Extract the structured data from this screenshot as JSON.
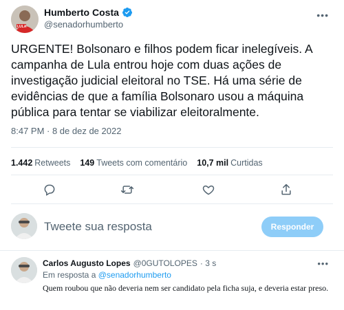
{
  "author": {
    "name": "Humberto Costa",
    "handle": "@senadorhumberto",
    "avatar_badge": "LULA"
  },
  "tweet": {
    "text": "URGENTE!  Bolsonaro e filhos podem ficar inelegíveis. A campanha de Lula entrou hoje com duas ações de investigação judicial eleitoral no TSE. Há uma série de evidências de que a família Bolsonaro usou a máquina pública para tentar se viabilizar eleitoralmente.",
    "timestamp": "8:47 PM · 8 de dez de 2022"
  },
  "stats": {
    "retweets_count": "1.442",
    "retweets_label": "Retweets",
    "quotes_count": "149",
    "quotes_label": "Tweets com comentário",
    "likes_count": "10,7 mil",
    "likes_label": "Curtidas"
  },
  "actions": [
    "reply-icon",
    "retweet-icon",
    "like-icon",
    "share-icon"
  ],
  "compose": {
    "placeholder": "Tweete sua resposta",
    "button_label": "Responder"
  },
  "reply": {
    "name": "Carlos Augusto Lopes",
    "handle": "@0GUTOLOPES",
    "time": "· 3 s",
    "in_reply_prefix": "Em resposta a",
    "in_reply_handle": "@senadorhumberto",
    "text": "Quem roubou que não deveria nem ser candidato pela ficha suja, e deveria estar preso."
  },
  "colors": {
    "accent": "#1d9bf0",
    "button_disabled": "#8ecdf8",
    "secondary_text": "#536471",
    "divider": "#e6ecf0"
  }
}
